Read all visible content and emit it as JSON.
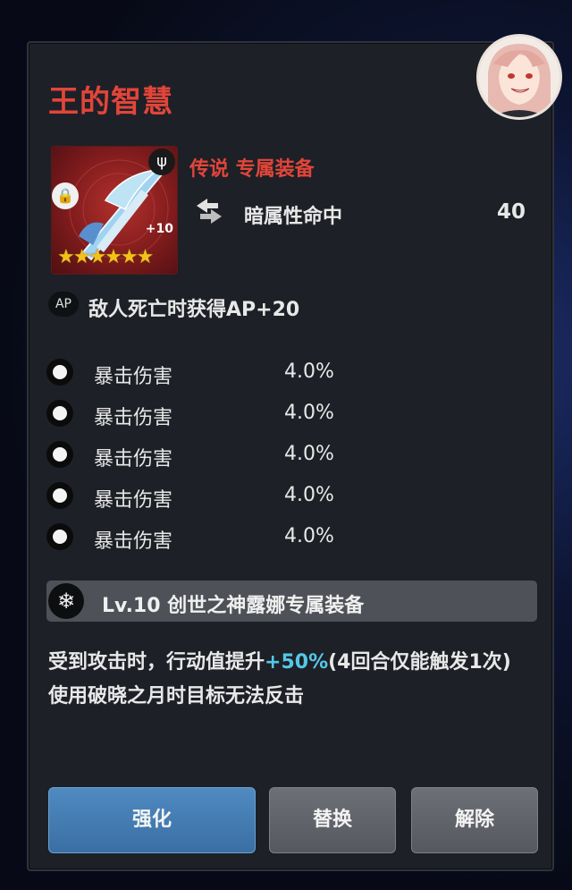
{
  "item": {
    "name": "王的智慧",
    "rarity_label": "传说 专属装备",
    "enhance_level": "+10",
    "stars": "★★★★★★",
    "main_stat": {
      "name": "暗属性命中",
      "value": "40"
    },
    "ap": {
      "badge": "AP",
      "text": "敌人死亡时获得AP+20"
    },
    "substats": [
      {
        "name": "暴击伤害",
        "value": "4.0%"
      },
      {
        "name": "暴击伤害",
        "value": "4.0%"
      },
      {
        "name": "暴击伤害",
        "value": "4.0%"
      },
      {
        "name": "暴击伤害",
        "value": "4.0%"
      },
      {
        "name": "暴击伤害",
        "value": "4.0%"
      }
    ],
    "set_label": "Lv.10 创世之神露娜专属装备",
    "effect": {
      "line1_prefix": "受到攻击时，行动值提升",
      "line1_highlight": "+50%",
      "line1_suffix": "(4回合仅能触发1次)",
      "line2": "使用破晓之月时目标无法反击"
    }
  },
  "buttons": {
    "enhance": "强化",
    "replace": "替换",
    "unequip": "解除"
  },
  "colors": {
    "title": "#e2453a",
    "highlight": "#55c7e8",
    "star": "#f2c21b",
    "primary_button": "#3a6fa3"
  },
  "icons": {
    "lock": "lock-icon",
    "weapon_type": "weapon-type-icon",
    "main_stat": "stat-arrow-icon",
    "substat": "substat-dot-icon",
    "set": "snowflake-icon"
  }
}
